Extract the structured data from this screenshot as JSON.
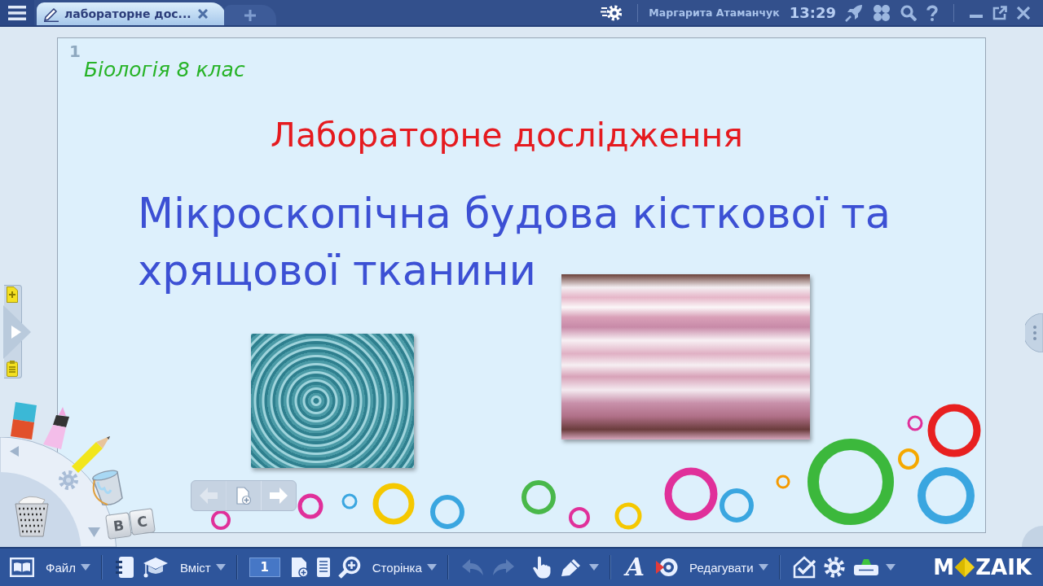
{
  "title_bar": {
    "tabs": [
      {
        "label": "лабораторне дос...",
        "selected": true
      }
    ],
    "user": "Маргарита Атаманчук",
    "time": "13:29"
  },
  "slide": {
    "number": "1",
    "subject": "Біологія 8 клас",
    "heading": "Лабораторне дослідження",
    "title": "Мікроскопічна будова кісткової та хрящової тканини"
  },
  "page_nav": {
    "back": {
      "disabled": true
    },
    "forward": {
      "disabled": false
    }
  },
  "tool_wheel": {
    "keys": [
      "B",
      "C"
    ]
  },
  "toolbar": {
    "menus": [
      "Файл",
      "Вміст",
      "Сторінка",
      "Редагувати"
    ],
    "page": "1",
    "undo": {
      "disabled": true
    },
    "redo": {
      "disabled": true
    },
    "text_tool": "A"
  },
  "logo": {
    "left": "M",
    "right": "ZAIK"
  }
}
